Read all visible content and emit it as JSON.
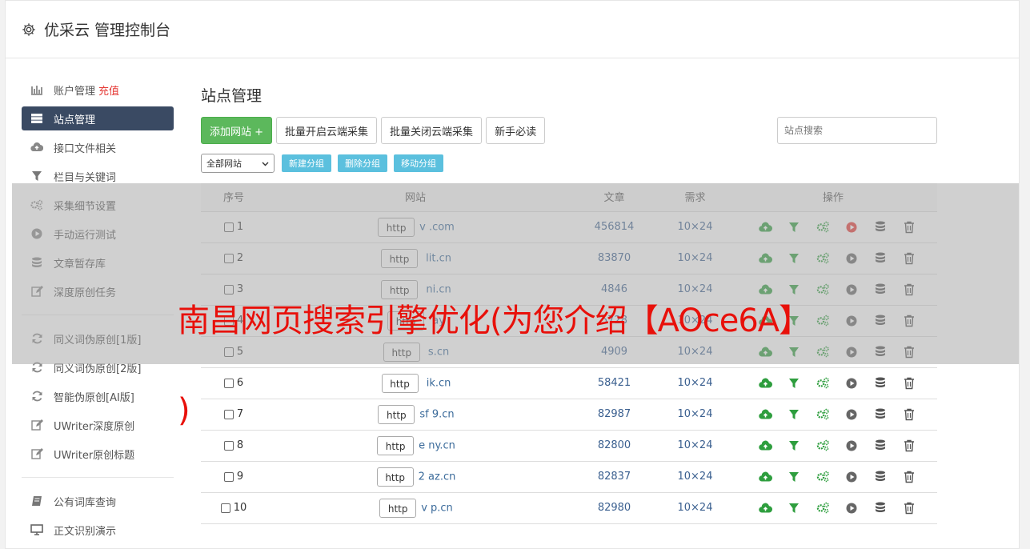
{
  "header": {
    "title": "优采云 管理控制台"
  },
  "sidebar": {
    "group1": [
      {
        "label": "账户管理",
        "badge": "充值",
        "icon": "bar-chart-icon"
      },
      {
        "label": "站点管理",
        "icon": "server-icon",
        "active": true
      },
      {
        "label": "接口文件相关",
        "icon": "cloud-upload-icon"
      },
      {
        "label": "栏目与关键词",
        "icon": "filter-icon"
      },
      {
        "label": "采集细节设置",
        "icon": "gears-icon"
      },
      {
        "label": "手动运行测试",
        "icon": "play-circle-icon"
      },
      {
        "label": "文章暂存库",
        "icon": "database-icon"
      },
      {
        "label": "深度原创任务",
        "icon": "edit-icon"
      }
    ],
    "group2": [
      {
        "label": "同义词伪原创[1版]",
        "icon": "refresh-icon"
      },
      {
        "label": "同义词伪原创[2版]",
        "icon": "refresh-icon"
      },
      {
        "label": "智能伪原创[AI版]",
        "icon": "refresh-icon"
      },
      {
        "label": "UWriter深度原创",
        "icon": "edit-icon"
      },
      {
        "label": "UWriter原创标题",
        "icon": "edit-icon"
      }
    ],
    "group3": [
      {
        "label": "公有词库查询",
        "icon": "book-icon"
      },
      {
        "label": "正文识别演示",
        "icon": "monitor-icon"
      }
    ]
  },
  "main": {
    "title": "站点管理",
    "add_site": "添加网站 +",
    "batch_open": "批量开启云端采集",
    "batch_close": "批量关闭云端采集",
    "guide": "新手必读",
    "search_placeholder": "站点搜索",
    "group_select": "全部网站",
    "new_group": "新建分组",
    "delete_group": "删除分组",
    "move_group": "移动分组"
  },
  "table": {
    "headers": {
      "no": "序号",
      "site": "网站",
      "articles": "文章",
      "demand": "需求",
      "ops": "操作"
    },
    "rows": [
      {
        "no": "1",
        "prefix": "http",
        "domain": "v            .com",
        "articles": "456814",
        "demand": "10×24"
      },
      {
        "no": "2",
        "prefix": "http",
        "domain": "    lit.cn",
        "articles": "83870",
        "demand": "10×24"
      },
      {
        "no": "3",
        "prefix": "http",
        "domain": "      ni.cn",
        "articles": "4846",
        "demand": "10×24"
      },
      {
        "no": "4",
        "prefix": "http",
        "domain": "     ay",
        "articles": "5728",
        "demand": "10×24"
      },
      {
        "no": "5",
        "prefix": "http",
        "domain": "        s.cn",
        "articles": "4909",
        "demand": "10×24"
      },
      {
        "no": "6",
        "prefix": "http",
        "domain": "     ik.cn",
        "articles": "58421",
        "demand": "10×24"
      },
      {
        "no": "7",
        "prefix": "http",
        "domain": "sf   9.cn",
        "articles": "82987",
        "demand": "10×24"
      },
      {
        "no": "8",
        "prefix": "http",
        "domain": "e     ny.cn",
        "articles": "82800",
        "demand": "10×24"
      },
      {
        "no": "9",
        "prefix": "http",
        "domain": "2    az.cn",
        "articles": "82837",
        "demand": "10×24"
      },
      {
        "no": "10",
        "prefix": "http",
        "domain": "v     p.cn",
        "articles": "82980",
        "demand": "10×24"
      }
    ]
  },
  "overlay": {
    "line1": "南昌网页搜索引擎优化(为您介绍【AOce6A】",
    "line2": ")"
  },
  "colors": {
    "active_nav": "#3a4a63",
    "green": "#5cb85c",
    "info": "#5bc0de",
    "red_badge": "#e53935",
    "overlay_text": "#e8100a"
  }
}
